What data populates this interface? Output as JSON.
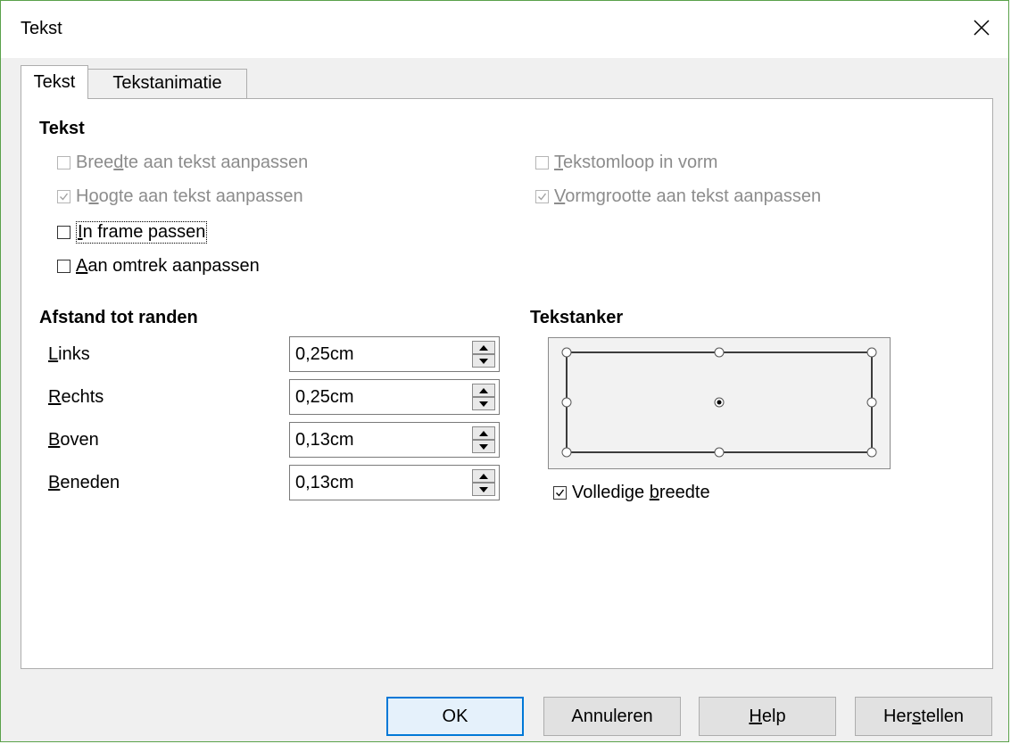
{
  "window": {
    "title": "Tekst"
  },
  "tabs": [
    {
      "label": "Tekst",
      "active": true
    },
    {
      "label": "Tekstanimatie",
      "active": false
    }
  ],
  "sections": {
    "text": {
      "heading": "Tekst",
      "options": {
        "fit_width": {
          "label": "Breedte aan tekst aanpassen",
          "checked": false,
          "enabled": false
        },
        "fit_height": {
          "label": "Hoogte aan tekst aanpassen",
          "checked": true,
          "enabled": false
        },
        "fit_frame": {
          "label": "In frame passen",
          "checked": false,
          "enabled": true
        },
        "fit_contour": {
          "label": "Aan omtrek aanpassen",
          "checked": false,
          "enabled": true
        },
        "wrap_shape": {
          "label": "Tekstomloop in vorm",
          "checked": false,
          "enabled": false
        },
        "resize_shape": {
          "label": "Vormgrootte aan tekst aanpassen",
          "checked": true,
          "enabled": false
        }
      }
    },
    "spacing": {
      "heading": "Afstand tot randen",
      "fields": [
        {
          "label": "Links",
          "value": "0,25cm"
        },
        {
          "label": "Rechts",
          "value": "0,25cm"
        },
        {
          "label": "Boven",
          "value": "0,13cm"
        },
        {
          "label": "Beneden",
          "value": "0,13cm"
        }
      ]
    },
    "anchor": {
      "heading": "Tekstanker",
      "selected": "center",
      "full_width": {
        "label": "Volledige breedte",
        "checked": true
      }
    }
  },
  "buttons": {
    "ok": "OK",
    "cancel": "Annuleren",
    "help": "Help",
    "reset": "Herstellen"
  },
  "colors": {
    "accent": "#0078d7",
    "window_border": "#5aa14a"
  }
}
